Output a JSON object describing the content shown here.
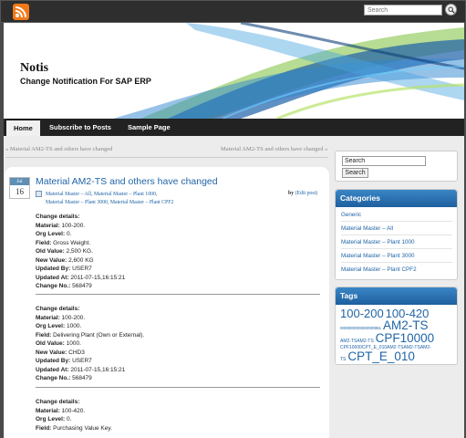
{
  "topbar": {
    "rss_icon": "rss-icon",
    "search_placeholder": "Search",
    "search_icon": "search-icon"
  },
  "site": {
    "title": "Notis",
    "description": "Change Notification For SAP ERP"
  },
  "nav": {
    "items": [
      "Home",
      "Subscribe to Posts",
      "Sample Page"
    ],
    "active": "Home"
  },
  "postnav": {
    "prev": "« Material AM2-TS and others have changed",
    "next": "Material AM2-TS and others have changed »"
  },
  "post": {
    "date_month": "Jul",
    "date_day": "16",
    "title": "Material AM2-TS and others have changed",
    "categories_line1": "Material Master – All, Material Master – Plant 1000,",
    "categories_line2": "Material Master – Plant 3000, Material Master – Plant CPF2",
    "by": "by",
    "edit": "(Edit post)",
    "entries": [
      {
        "heading": "Change details:",
        "material_label": "Material:",
        "material": "100-200.",
        "org_label": "Org Level:",
        "org": "0.",
        "field_label": "Field:",
        "field": "Gross Weight.",
        "old_label": "Old Value:",
        "old": "2,500 KG.",
        "new_label": "New Value:",
        "new": "2,600 KG",
        "by_label": "Updated By:",
        "by": "USER7",
        "at_label": "Updated At:",
        "at": "2011-07-15,16:15:21",
        "no_label": "Change No.:",
        "no": "568479"
      },
      {
        "heading": "Change details:",
        "material_label": "Material:",
        "material": "100-200.",
        "org_label": "Org Level:",
        "org": "1000.",
        "field_label": "Field:",
        "field": "Delivering Plant (Own or External).",
        "old_label": "Old Value:",
        "old": "1000.",
        "new_label": "New Value:",
        "new": "CHD3",
        "by_label": "Updated By:",
        "by": "USER7",
        "at_label": "Updated At:",
        "at": "2011-07-15,16:15:21",
        "no_label": "Change No.:",
        "no": "568479"
      },
      {
        "heading": "Change details:",
        "material_label": "Material:",
        "material": "100-420.",
        "org_label": "Org Level:",
        "org": "0.",
        "field_label": "Field:",
        "field": "Purchasing Value Key."
      }
    ]
  },
  "sidebar": {
    "search_value": "Search",
    "search_button": "Search",
    "categories_title": "Categories",
    "categories": [
      "Generic",
      "Material Master – All",
      "Material Master – Plant 1000",
      "Material Master – Plant 3000",
      "Material Master – Plant CPF2"
    ],
    "tags_title": "Tags",
    "tags": {
      "t1": "100-200",
      "t2": "100-420",
      "t3": "000000000000000951",
      "t4": "AM2-TS",
      "t5": "AM2-TSAM2-TS",
      "t6": "CPF10000",
      "t7": "CPF10000CPT_E_010AM2-TSAM2-TSAM2-",
      "t8": "TS",
      "t9": "CPT_E_010"
    }
  },
  "colors": {
    "accent": "#2165a7",
    "widget_header": "#2f76b8",
    "rss": "#ef7a1a",
    "nav_bg": "#222222"
  }
}
